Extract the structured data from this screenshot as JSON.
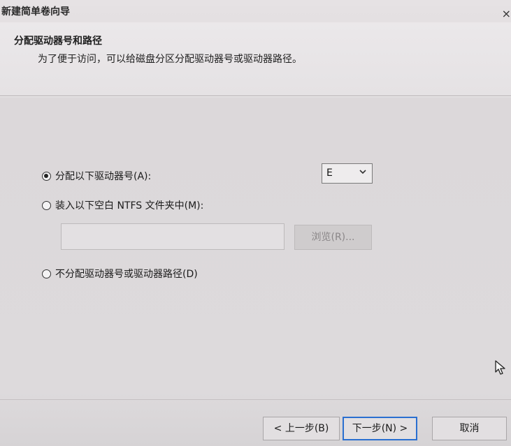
{
  "window": {
    "title": "新建简单卷向导",
    "close_glyph": "×"
  },
  "header": {
    "title": "分配驱动器号和路径",
    "subtitle": "为了便于访问，可以给磁盘分区分配驱动器号或驱动器路径。"
  },
  "options": [
    {
      "label": "分配以下驱动器号(A):",
      "checked": true
    },
    {
      "label": "装入以下空白 NTFS 文件夹中(M):",
      "checked": false
    },
    {
      "label": "不分配驱动器号或驱动器路径(D)",
      "checked": false
    }
  ],
  "drive_letter": {
    "value": "E"
  },
  "folder_path": {
    "value": ""
  },
  "browse": {
    "label": "浏览(R)..."
  },
  "buttons": {
    "back": "< 上一步(B)",
    "next": "下一步(N) >",
    "cancel": "取消"
  },
  "icons": {
    "close": "close-icon",
    "chevron": "chevron-down-icon",
    "cursor": "mouse-pointer-icon"
  },
  "colors": {
    "default_button_border": "#2a6fd0"
  }
}
